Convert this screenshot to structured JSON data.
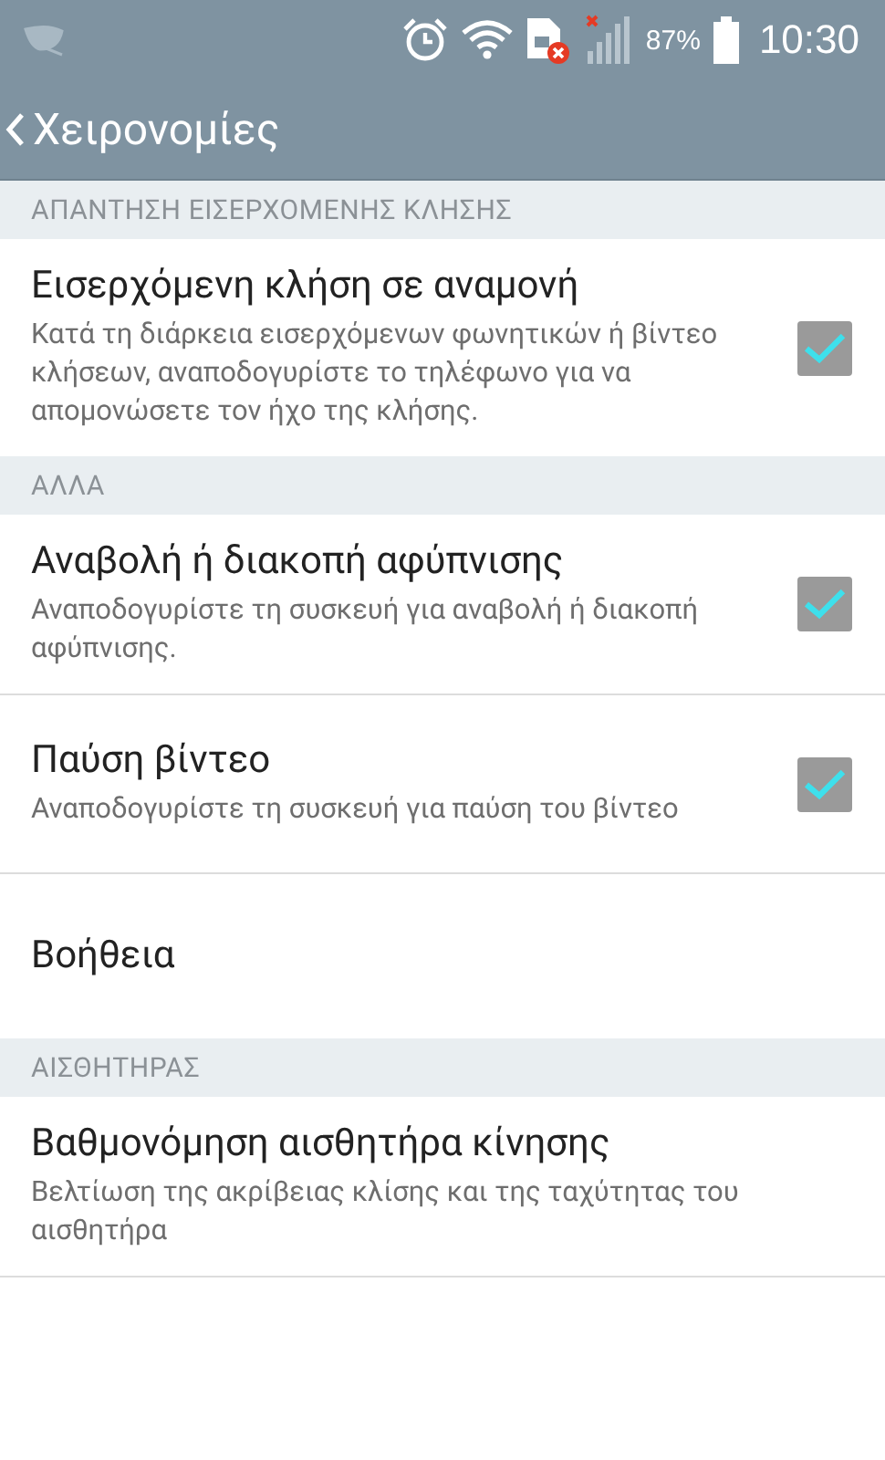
{
  "status_bar": {
    "battery": "87%",
    "time": "10:30"
  },
  "app_bar": {
    "title": "Χειρονομίες"
  },
  "sections": [
    {
      "header": "ΑΠΑΝΤΗΣΗ ΕΙΣΕΡΧΟΜΕΝΗΣ ΚΛΗΣΗΣ",
      "items": [
        {
          "kind": "checkbox",
          "title": "Εισερχόμενη κλήση σε αναμονή",
          "summary": "Κατά τη διάρκεια εισερχόμενων φωνητικών ή βίντεο κλήσεων, αναποδογυρίστε το τηλέφωνο για να απομονώσετε τον ήχο της κλήσης.",
          "checked": true
        }
      ]
    },
    {
      "header": "ΑΛΛΑ",
      "items": [
        {
          "kind": "checkbox",
          "title": "Αναβολή ή διακοπή αφύπνισης",
          "summary": "Αναποδογυρίστε τη συσκευή για αναβολή ή διακοπή αφύπνισης.",
          "checked": true
        },
        {
          "kind": "checkbox",
          "title": "Παύση βίντεο",
          "summary": "Αναποδογυρίστε τη συσκευή για παύση του βίντεο",
          "checked": true
        },
        {
          "kind": "plain",
          "title": "Βοήθεια"
        }
      ]
    },
    {
      "header": "ΑΙΣΘΗΤΗΡΑΣ",
      "items": [
        {
          "kind": "plain",
          "title": "Βαθμονόμηση αισθητήρα κίνησης",
          "summary": "Βελτίωση της ακρίβειας κλίσης και της ταχύτητας του αισθητήρα"
        }
      ]
    }
  ]
}
